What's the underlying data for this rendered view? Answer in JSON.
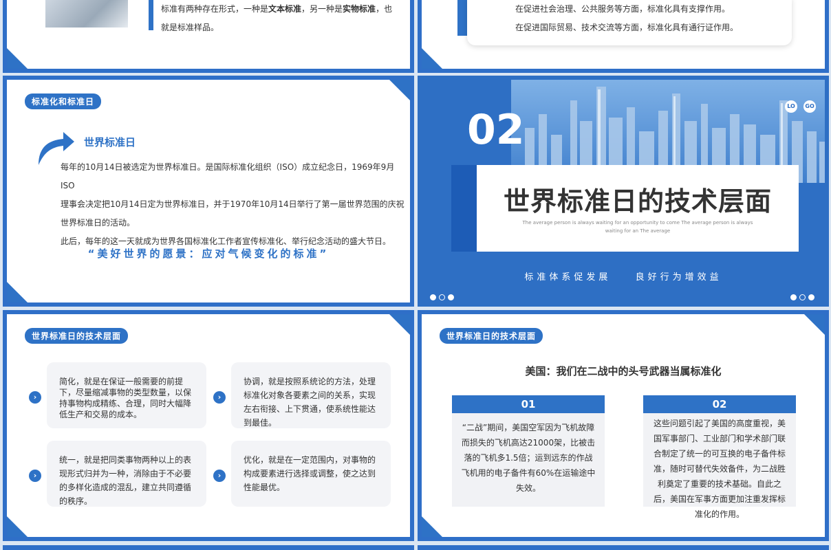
{
  "s1": {
    "line1_pre": "标准有两种存在形式，一种是",
    "line1_b1": "文本标准",
    "line1_mid": "，另一种是",
    "line1_b2": "实物标准",
    "line1_post": "，也",
    "line2": "就是标准样品。"
  },
  "s2": {
    "line1": "在促进社会治理、公共服务等方面，标准化具有支撑作用。",
    "line2": "在促进国际贸易、技术交流等方面，标准化具有通行证作用。"
  },
  "s3": {
    "tag": "标准化和标准日",
    "heading": "世界标准日",
    "p1": "每年的10月14日被选定为世界标准日。是国际标准化组织（ISO）成立纪念日，1969年9月ISO",
    "p2": "理事会决定把10月14日定为世界标准日，并于1970年10月14日举行了第一届世界范围的庆祝",
    "p3": "世界标准日的活动。",
    "p4": "此后，每年的这一天就成为世界各国标准化工作者宣传标准化、举行纪念活动的盛大节日。",
    "quote": "“美好世界的愿景：应对气候变化的标准”"
  },
  "s4": {
    "number": "02",
    "logo1": "LO",
    "logo2": "GO",
    "title": "世界标准日的技术层面",
    "sub1": "The average person is always waiting for an opportunity to come The average person is always",
    "sub2": "waiting for an The average",
    "slogan1": "标准体系促发展",
    "slogan2": "良好行为增效益"
  },
  "s5": {
    "tag": "世界标准日的技术层面",
    "cards": [
      {
        "text": "简化，就是在保证一般需要的前提下，尽量缩减事物的类型数量，以保持事物构成精练、合理，同时大幅降低生产和交易的成本。"
      },
      {
        "text": "协调，就是按照系统论的方法，处理标准化对象各要素之间的关系，实现左右衔接、上下贯通，使系统性能达到最佳。"
      },
      {
        "text": "统一，就是把同类事物两种以上的表现形式归并为一种，消除由于不必要的多样化造成的混乱，建立共同遵循的秩序。"
      },
      {
        "text": "优化，就是在一定范围内，对事物的构成要素进行选择或调整，使之达到性能最优。"
      }
    ]
  },
  "s6": {
    "tag": "世界标准日的技术层面",
    "heading": "美国：我们在二战中的头号武器当属标准化",
    "box1_num": "01",
    "box1_text": "“二战”期间，美国空军因为飞机故障而损失的飞机高达21000架，比被击落的飞机多1.5倍；运到远东的作战飞机用的电子备件有60%在运输途中失效。",
    "box2_num": "02",
    "box2_text": "这些问题引起了美国的高度重视，美国军事部门、工业部门和学术部门联合制定了统一的可互换的电子备件标准，随时可替代失效备件，为二战胜利奠定了重要的技术基础。自此之后，美国在军事方面更加注重发挥标准化的作用。"
  },
  "colors": {
    "accent": "#2e72c6",
    "dark_blue": "#1f5fb8"
  }
}
